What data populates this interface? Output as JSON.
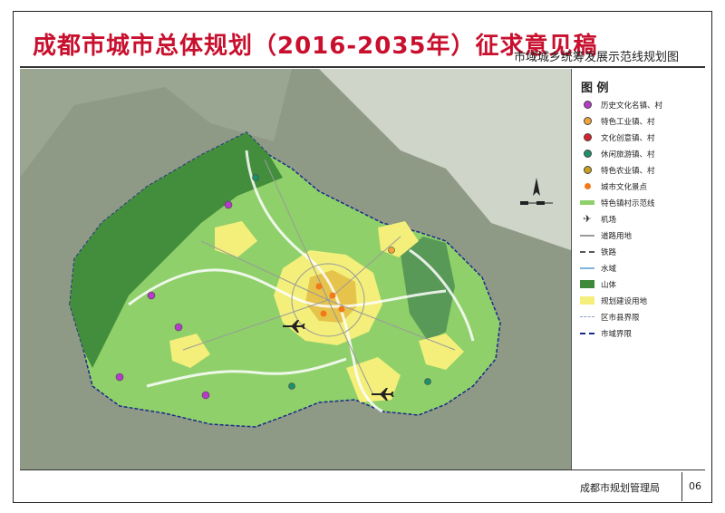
{
  "header": {
    "title": "成都市城市总体规划（2016-2035年）征求意见稿",
    "subtitle": "市域城乡统筹发展示范线规划图"
  },
  "legend": {
    "title": "图 例",
    "items": [
      {
        "label": "历史文化名镇、村",
        "icon": "purple-dot-icon",
        "color": "#b43cc8"
      },
      {
        "label": "特色工业镇、村",
        "icon": "orange-dot-icon",
        "color": "#f2a33a"
      },
      {
        "label": "文化创意镇、村",
        "icon": "red-dot-icon",
        "color": "#d8232a"
      },
      {
        "label": "休闲旅游镇、村",
        "icon": "teal-dot-icon",
        "color": "#1f8f6a"
      },
      {
        "label": "特色农业镇、村",
        "icon": "crop-dot-icon",
        "color": "#c8a020"
      },
      {
        "label": "城市文化景点",
        "icon": "orange-point-icon",
        "color": "#f07a1a"
      },
      {
        "label": "特色镇村示范线",
        "icon": "green-band-icon",
        "color": "#8fd06a"
      },
      {
        "label": "机场",
        "icon": "airplane-icon",
        "color": "#222222"
      },
      {
        "label": "道路用地",
        "icon": "road-line-icon",
        "color": "#9a9a9a"
      },
      {
        "label": "铁路",
        "icon": "railway-icon",
        "color": "#555555"
      },
      {
        "label": "水域",
        "icon": "water-icon",
        "color": "#7fb3e0"
      },
      {
        "label": "山体",
        "icon": "mountain-swatch-icon",
        "color": "#3f8a3a"
      },
      {
        "label": "规划建设用地",
        "icon": "construction-swatch-icon",
        "color": "#f3ef7a"
      },
      {
        "label": "区市县界限",
        "icon": "county-boundary-icon",
        "color": "#8aa0c8"
      },
      {
        "label": "市域界限",
        "icon": "city-boundary-icon",
        "color": "#1a2a8a"
      }
    ]
  },
  "footer": {
    "agency": "成都市规划管理局",
    "page": "06"
  },
  "map": {
    "colors": {
      "mountain": "#3f8a3a",
      "farmland": "#8fd06a",
      "urban": "#f3ef7a",
      "core": "#e6c34a",
      "surround": "#8f9a86",
      "haze": "#d7dcd2"
    }
  }
}
